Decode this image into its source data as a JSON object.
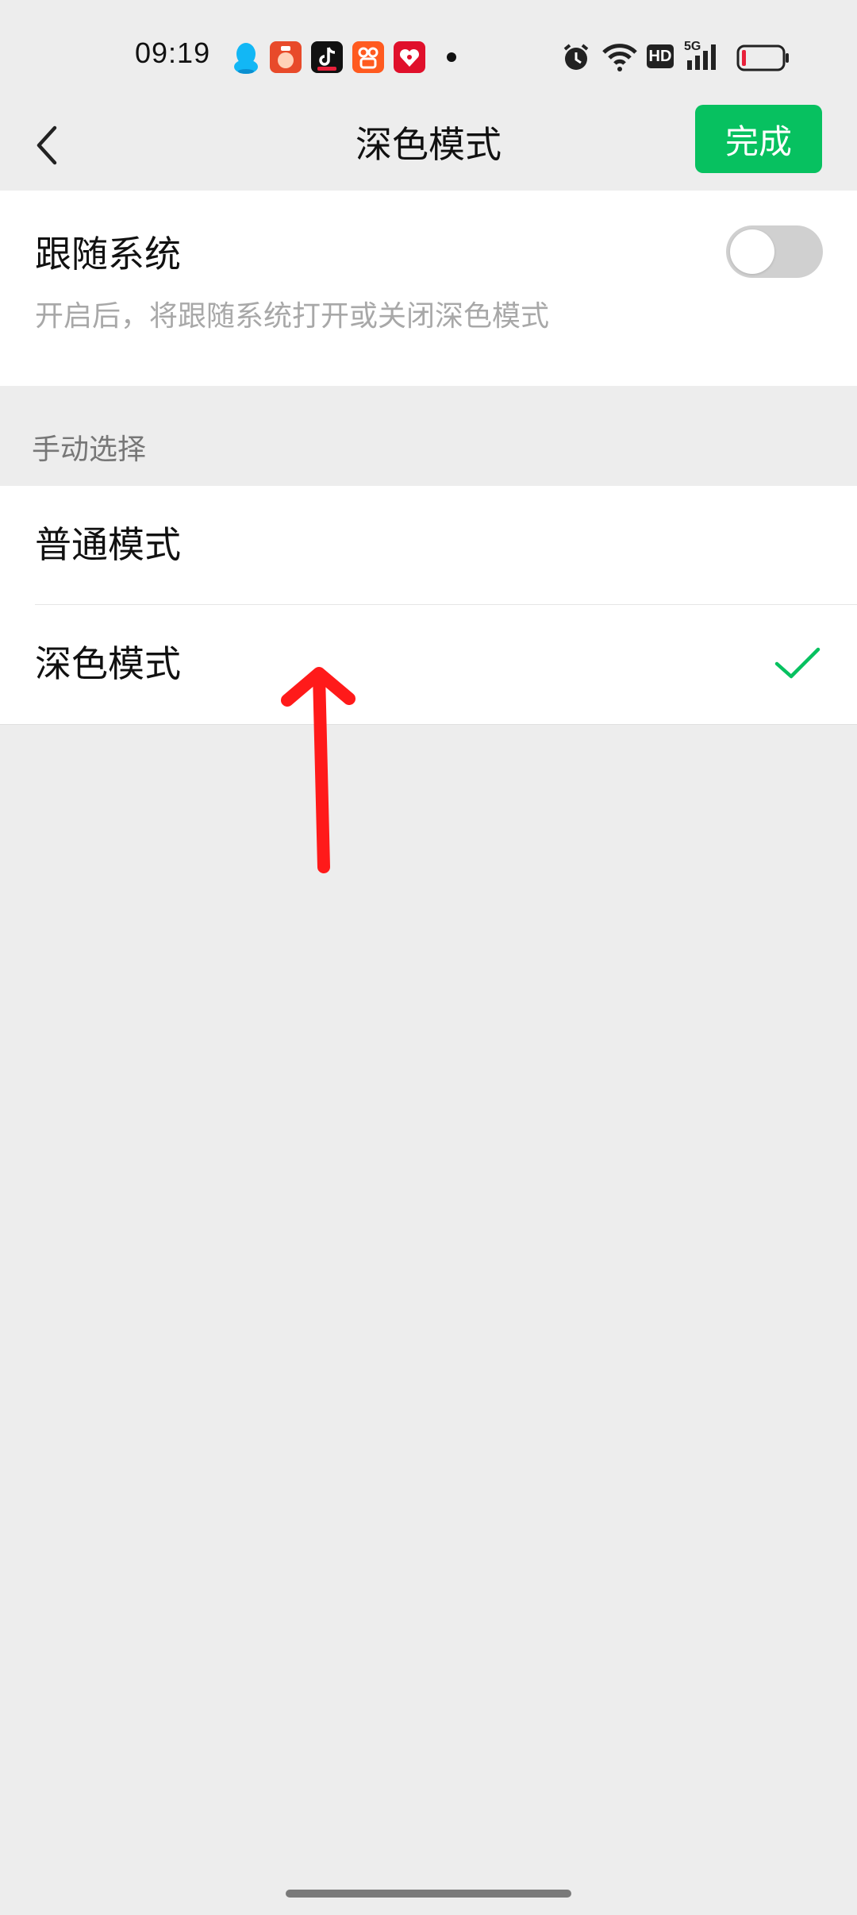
{
  "status_bar": {
    "time": "09:19",
    "notification_icons": [
      "qq-icon",
      "app-red-icon",
      "tiktok-icon",
      "kuaishou-icon",
      "pinduoduo-icon"
    ],
    "right_icons": [
      "alarm-icon",
      "wifi-icon",
      "hd-icon",
      "5g-signal-icon",
      "battery-icon"
    ],
    "signal_label": "5G",
    "hd_label": "HD"
  },
  "nav": {
    "title": "深色模式",
    "done_label": "完成"
  },
  "follow_system": {
    "title": "跟随系统",
    "description": "开启后，将跟随系统打开或关闭深色模式",
    "enabled": false
  },
  "manual": {
    "section_label": "手动选择",
    "options": [
      {
        "label": "普通模式",
        "selected": false
      },
      {
        "label": "深色模式",
        "selected": true
      }
    ]
  },
  "colors": {
    "accent": "#07c160",
    "background": "#ededed",
    "annotation": "#ff1a1a"
  }
}
